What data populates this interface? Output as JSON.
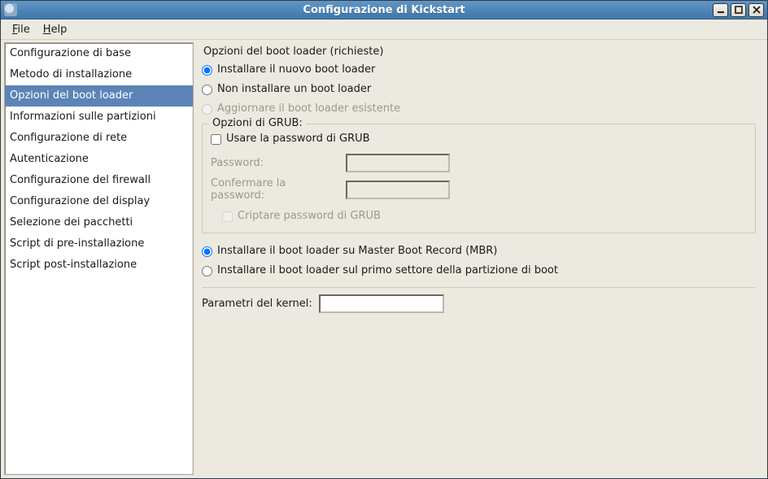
{
  "window": {
    "title": "Configurazione di Kickstart"
  },
  "menu": {
    "file": "File",
    "help": "Help"
  },
  "sidebar": {
    "items": [
      {
        "label": "Configurazione di base",
        "selected": false
      },
      {
        "label": "Metodo di installazione",
        "selected": false
      },
      {
        "label": "Opzioni del boot loader",
        "selected": true
      },
      {
        "label": "Informazioni sulle partizioni",
        "selected": false
      },
      {
        "label": "Configurazione di rete",
        "selected": false
      },
      {
        "label": "Autenticazione",
        "selected": false
      },
      {
        "label": "Configurazione del firewall",
        "selected": false
      },
      {
        "label": "Configurazione del display",
        "selected": false
      },
      {
        "label": "Selezione dei pacchetti",
        "selected": false
      },
      {
        "label": "Script di pre-installazione",
        "selected": false
      },
      {
        "label": "Script post-installazione",
        "selected": false
      }
    ]
  },
  "content": {
    "section_title": "Opzioni del boot loader (richieste)",
    "install_opts": {
      "install_new": "Installare il nuovo boot loader",
      "no_install": "Non installare un boot loader",
      "upgrade": "Aggiornare il boot loader esistente",
      "selected": "install_new"
    },
    "grub": {
      "legend": "Opzioni di GRUB:",
      "use_pw_label": "Usare la password di GRUB",
      "password_label": "Password:",
      "confirm_label": "Confermare la password:",
      "encrypt_label": "Criptare password di GRUB",
      "use_pw_checked": false,
      "encrypt_checked": false,
      "password_value": "",
      "confirm_value": ""
    },
    "install_loc": {
      "mbr": "Installare il boot loader su Master Boot Record (MBR)",
      "part": "Installare il boot loader sul primo settore della partizione di boot",
      "selected": "mbr"
    },
    "kernel": {
      "label": "Parametri del kernel:",
      "value": ""
    }
  }
}
